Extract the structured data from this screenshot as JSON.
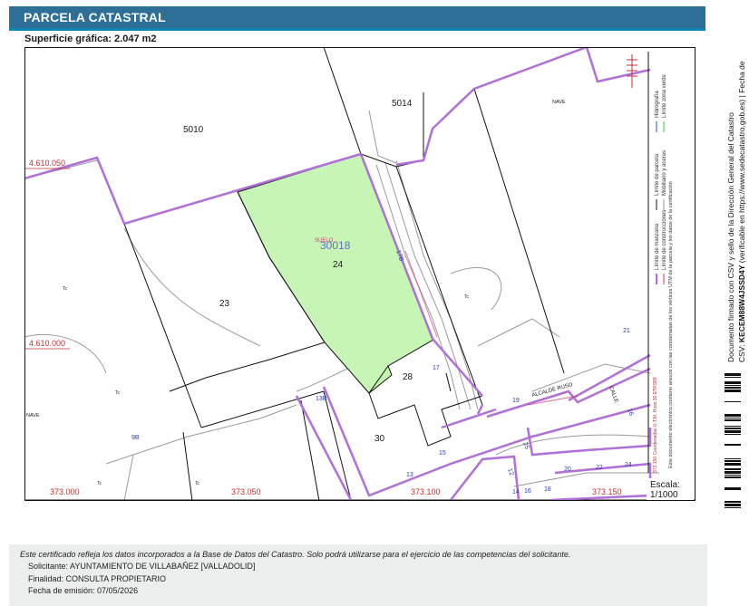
{
  "header": {
    "title": "PARCELA CATASTRAL"
  },
  "surface": {
    "label": "Superficie gráfica: 2.047 m2"
  },
  "map": {
    "parcel_id": "30018",
    "parcel_number": "24",
    "subparcel_label": "SUELO",
    "parcel_fill": "#c6f5b5",
    "block_labels": {
      "north": "5010",
      "northeast": "5014"
    },
    "parcel_labels": [
      "23",
      "28",
      "30"
    ],
    "street_numbers": [
      "17B",
      "17",
      "13B",
      "9B",
      "19",
      "15",
      "13",
      "16",
      "25",
      "12",
      "14",
      "16",
      "18",
      "20",
      "22",
      "24",
      "21"
    ],
    "street_names": [
      "ALCALDE RUSO",
      "CALLE"
    ],
    "building_tags": [
      "NAVE",
      "NAVE",
      "Tc",
      "Tc",
      "Tc",
      "Tc",
      "Tc"
    ],
    "coordinates": {
      "y1": "4.610.050",
      "y2": "4.610.000",
      "x1": "373.000",
      "x2": "373.050",
      "x3": "373.100",
      "x4": "373.150"
    },
    "compass": "N"
  },
  "legend": {
    "col1": [
      "Límite de manzana",
      "Límite de construcciones"
    ],
    "col2": [
      "Límite de parcela",
      "Mobiliario y aceras"
    ],
    "col3": [
      "Hidrografía",
      "Límite zona verde"
    ],
    "coords_note": "373.150 Coordenadas U.T.M. Huso 30 ETRS89",
    "doc_note1": "Este documento electrónico contiene anexos con las coordenadas de los vértices UTM de la parcela y los datos de la certificación",
    "colors": {
      "manzana": "#b070d8",
      "construcciones": "#d23a7a",
      "parcela": "#111111",
      "mobiliario": "#999999",
      "hidrografia": "#3050c0",
      "zona_verde": "#40c040"
    }
  },
  "scale": {
    "label": "Escala:",
    "value": "1/1000"
  },
  "side": {
    "line1": "Documento firmado con CSV y sello de la Dirección General del Catastro",
    "line2_prefix": "CSV: ",
    "line2_csv": "KECEM88W4JSSD4Y",
    "line2_suffix": " (verificable en https://www.sedecatastro.gob.es)  |  Fecha de"
  },
  "footer": {
    "disclaimer": "Este certificado refleja los datos incorporados a la Base de Datos del Catastro. Solo podrá utilizarse para el ejercicio de las competencias del solicitante.",
    "solicitante": "Solicitante:  AYUNTAMIENTO DE VILLABAÑEZ [VALLADOLID]",
    "finalidad": "Finalidad:  CONSULTA PROPIETARIO",
    "fecha": "Fecha de emisión:  07/05/2026"
  }
}
